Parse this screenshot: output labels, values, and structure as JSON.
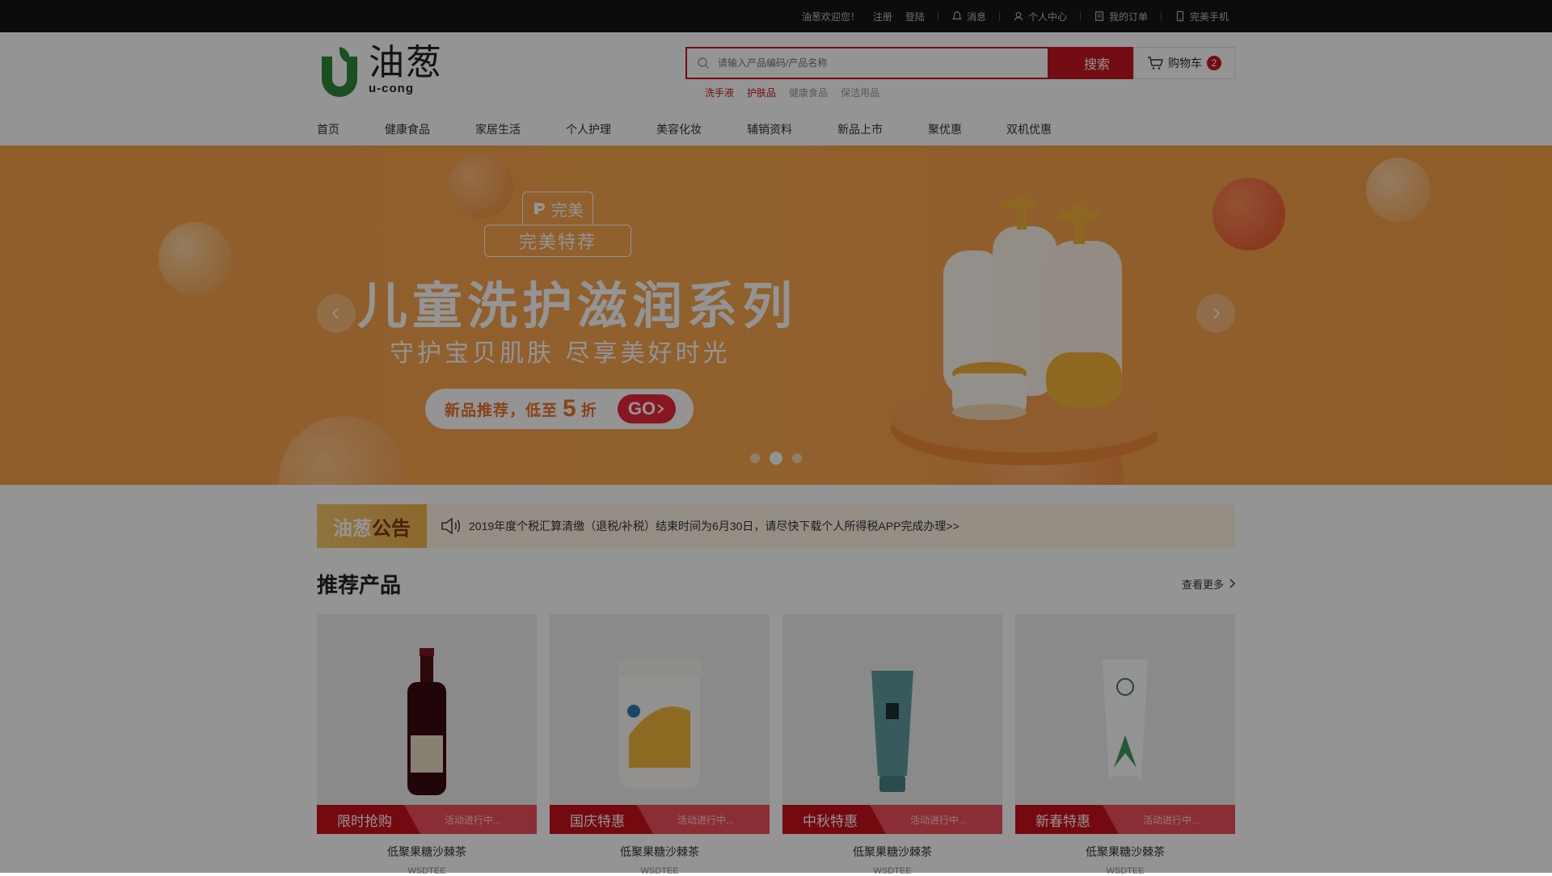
{
  "topbar": {
    "welcome": "油葱欢迎您！",
    "register": "注册",
    "login": "登陆",
    "messages": "消息",
    "user_center": "个人中心",
    "orders": "我的订单",
    "mobile": "完美手机"
  },
  "logo": {
    "cn": "油葱",
    "en": "u-cong"
  },
  "search": {
    "placeholder": "请输入产品编码/产品名称",
    "button": "搜索",
    "hot": [
      "洗手液",
      "护肤品",
      "健康食品",
      "保洁用品"
    ]
  },
  "cart": {
    "label": "购物车",
    "count": "2"
  },
  "nav": [
    "首页",
    "健康食品",
    "家居生活",
    "个人护理",
    "美容化妆",
    "辅销资料",
    "新品上市",
    "聚优惠",
    "双机优惠"
  ],
  "banner": {
    "brand_top": "完美",
    "brand_bottom": "完美特荐",
    "title": "儿童洗护滋润系列",
    "subtitle": "守护宝贝肌肤 尽享美好时光",
    "pill_text_a": "新品推荐，低至",
    "pill_num": "5",
    "pill_text_b": "折",
    "pill_go": "GO"
  },
  "notice": {
    "label_a": "油葱",
    "label_b": "公告",
    "text": "2019年度个税汇算清缴（退税/补税）结束时间为6月30日，请尽快下载个人所得税APP完成办理>>"
  },
  "products": {
    "title": "推荐产品",
    "more": "查看更多",
    "items": [
      {
        "tag": "限时抢购",
        "status": "活动进行中...",
        "name": "低聚果糖沙棘茶",
        "code": "WSDTEE"
      },
      {
        "tag": "国庆特惠",
        "status": "活动进行中...",
        "name": "低聚果糖沙棘茶",
        "code": "WSDTEE"
      },
      {
        "tag": "中秋特惠",
        "status": "活动进行中...",
        "name": "低聚果糖沙棘茶",
        "code": "WSDTEE"
      },
      {
        "tag": "新春特惠",
        "status": "活动进行中...",
        "name": "低聚果糖沙棘茶",
        "code": "WSDTEE"
      }
    ]
  },
  "colors": {
    "accent": "#c91623",
    "banner": "#f9a24a",
    "topbar": "#151515"
  }
}
